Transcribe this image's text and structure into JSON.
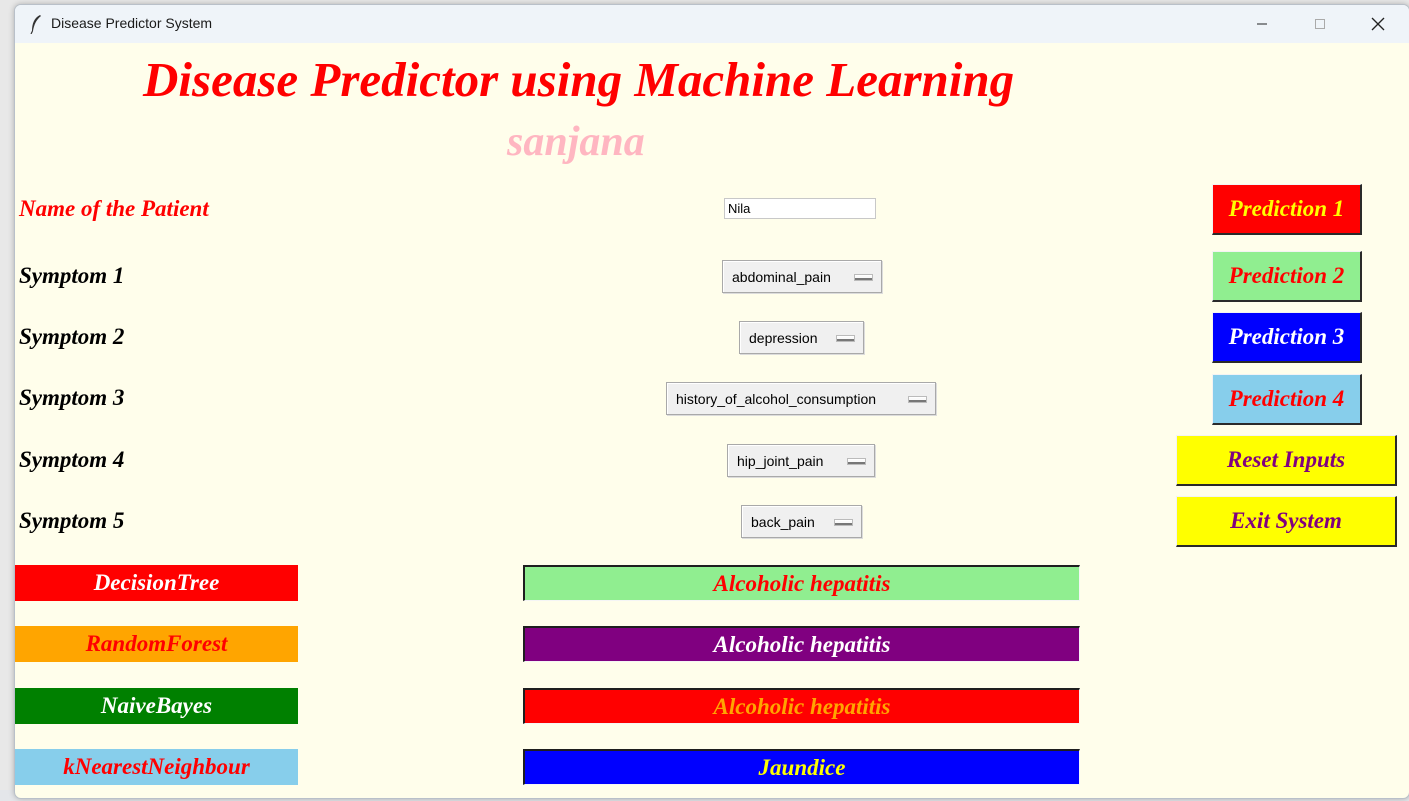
{
  "window": {
    "title": "Disease Predictor System",
    "controls": {
      "minimize": "—",
      "maximize": "☐",
      "close": "✕"
    }
  },
  "header": {
    "title": "Disease Predictor using Machine Learning",
    "subtitle": "sanjana"
  },
  "patient": {
    "label": "Name of the Patient",
    "value": "Nila"
  },
  "symptoms": [
    {
      "label": "Symptom 1",
      "selected": "abdominal_pain"
    },
    {
      "label": "Symptom 2",
      "selected": "depression"
    },
    {
      "label": "Symptom 3",
      "selected": "history_of_alcohol_consumption"
    },
    {
      "label": "Symptom 4",
      "selected": "hip_joint_pain"
    },
    {
      "label": "Symptom 5",
      "selected": "back_pain"
    }
  ],
  "buttons": {
    "prediction1": "Prediction 1",
    "prediction2": "Prediction 2",
    "prediction3": "Prediction 3",
    "prediction4": "Prediction 4",
    "reset": "Reset Inputs",
    "exit": "Exit System"
  },
  "algorithms": [
    {
      "label": "DecisionTree",
      "result": "Alcoholic hepatitis"
    },
    {
      "label": "RandomForest",
      "result": "Alcoholic hepatitis"
    },
    {
      "label": "NaiveBayes",
      "result": "Alcoholic hepatitis"
    },
    {
      "label": "kNearestNeighbour",
      "result": "Jaundice"
    }
  ],
  "colors": {
    "window_bg": "#fffeeb",
    "title_red": "#ff0000",
    "subtitle_pink": "#ffb6c1",
    "prediction1_bg": "#ff0000",
    "prediction2_bg": "#90ee90",
    "prediction3_bg": "#0000ff",
    "prediction4_bg": "#87ceeb",
    "reset_exit_bg": "#ffff00",
    "decision_tree_bg": "#ff0000",
    "random_forest_bg": "#ffa500",
    "naive_bayes_bg": "#008000",
    "knn_bg": "#87ceeb",
    "result1_bg": "#90ee90",
    "result2_bg": "#800080",
    "result3_bg": "#ff0000",
    "result4_bg": "#0000ff"
  },
  "icons": {
    "app": "feather-icon",
    "dropdown": "option-menu-indicator-icon"
  }
}
